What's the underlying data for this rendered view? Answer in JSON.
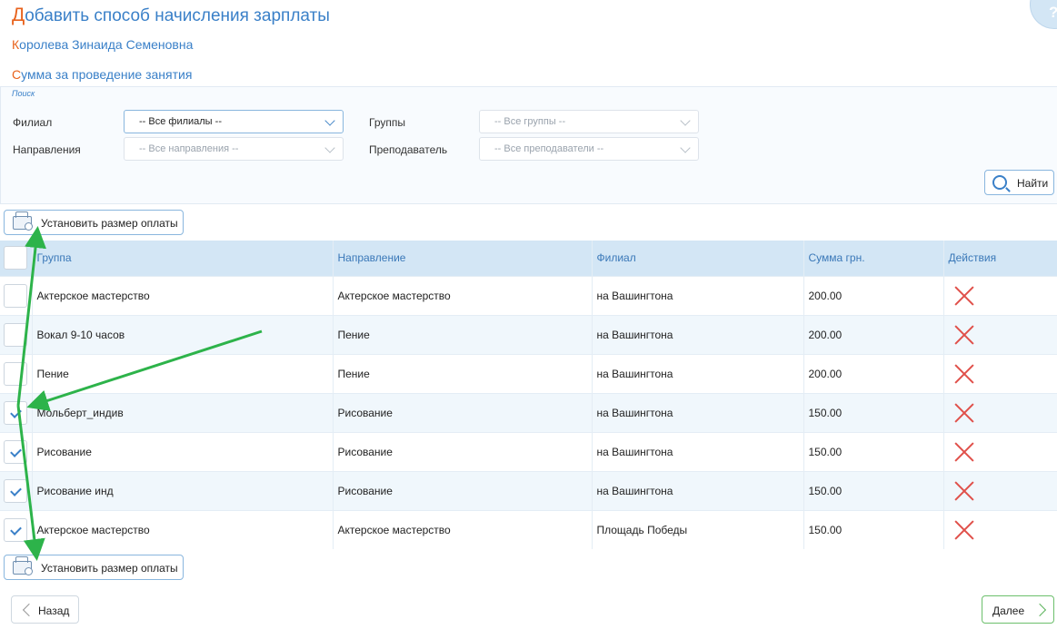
{
  "header": {
    "title_initial": "Д",
    "title_rest": "обавить способ начисления зарплаты",
    "employee_initial": "К",
    "employee_rest": "оролева Зинаида Семеновна",
    "method_initial": "С",
    "method_rest": "умма за проведение занятия",
    "help_glyph": "?"
  },
  "search": {
    "caption": "Поиск",
    "branch_label": "Филиал",
    "branch_value": "-- Все филиалы --",
    "direction_label": "Направления",
    "direction_value": "-- Все направления --",
    "groups_label": "Группы",
    "groups_value": "-- Все группы --",
    "teacher_label": "Преподаватель",
    "teacher_value": "-- Все преподаватели --",
    "find_label": "Найти"
  },
  "actions": {
    "set_payment_label": "Установить размер оплаты"
  },
  "table": {
    "headers": {
      "group": "Группа",
      "direction": "Направление",
      "branch": "Филиал",
      "amount": "Сумма грн.",
      "actions": "Действия"
    },
    "rows": [
      {
        "checked": false,
        "group": "Актерское мастерство",
        "direction": "Актерское мастерство",
        "branch": "на Вашингтона",
        "amount": "200.00"
      },
      {
        "checked": false,
        "group": "Вокал 9-10 часов",
        "direction": "Пение",
        "branch": "на Вашингтона",
        "amount": "200.00"
      },
      {
        "checked": false,
        "group": "Пение",
        "direction": "Пение",
        "branch": "на Вашингтона",
        "amount": "200.00"
      },
      {
        "checked": true,
        "group": "Мольберт_индив",
        "direction": "Рисование",
        "branch": "на Вашингтона",
        "amount": "150.00"
      },
      {
        "checked": true,
        "group": "Рисование",
        "direction": "Рисование",
        "branch": "на Вашингтона",
        "amount": "150.00"
      },
      {
        "checked": true,
        "group": "Рисование инд",
        "direction": "Рисование",
        "branch": "на Вашингтона",
        "amount": "150.00"
      },
      {
        "checked": true,
        "group": "Актерское мастерство",
        "direction": "Актерское мастерство",
        "branch": "Площадь Победы",
        "amount": "150.00"
      }
    ]
  },
  "footer": {
    "back_label": "Назад",
    "next_label": "Далее"
  },
  "colors": {
    "accent": "#3a80c8",
    "initial_letter": "#e8621c",
    "header_row": "#d3e6f5",
    "delete": "#e0504a",
    "annotation_arrow": "#2db34a"
  }
}
